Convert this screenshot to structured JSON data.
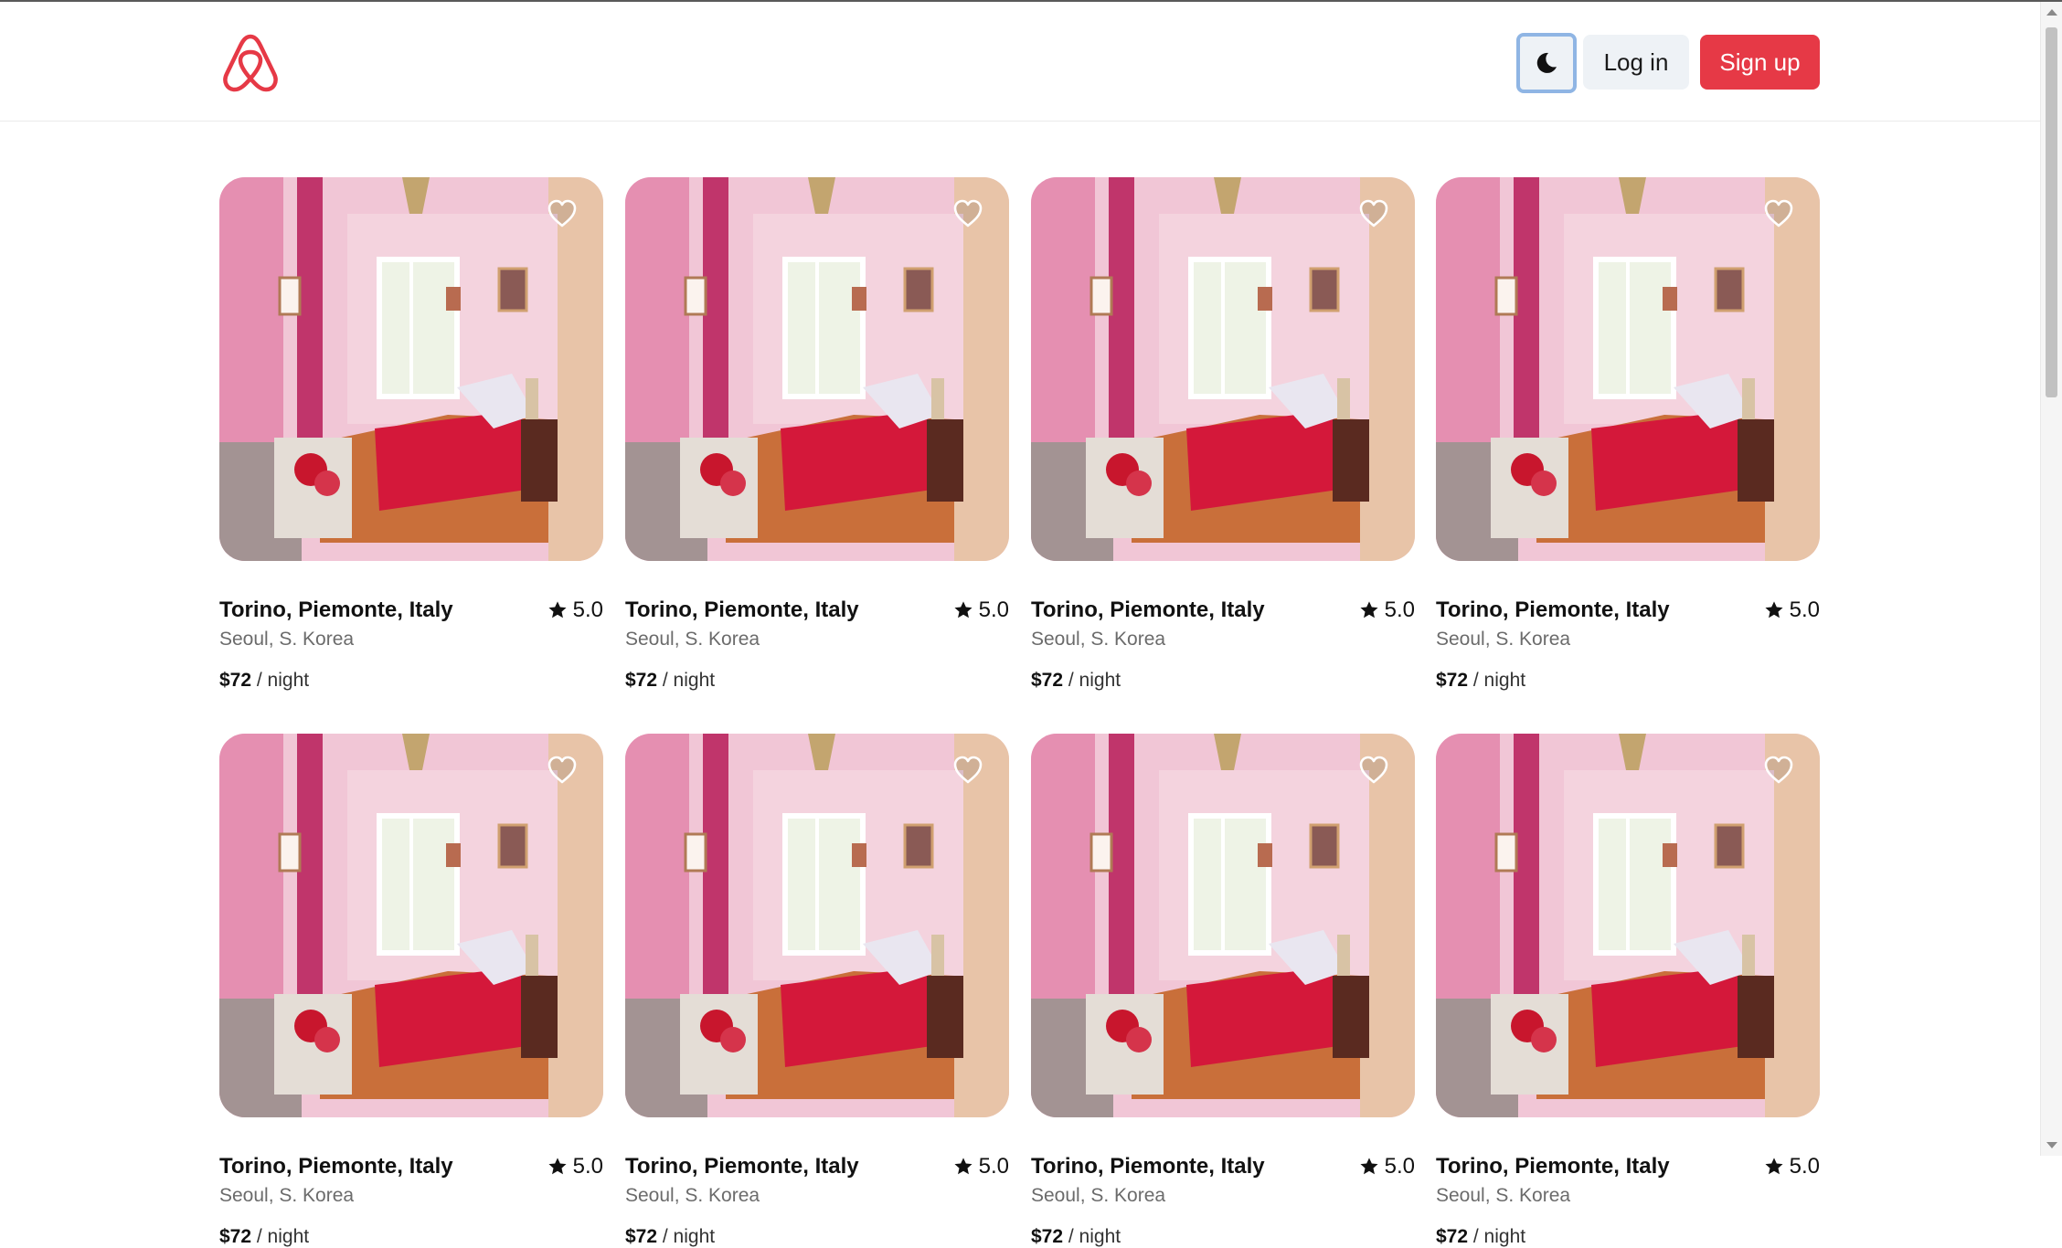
{
  "header": {
    "logo_icon": "airbnb-logo-icon",
    "theme_icon": "moon-icon",
    "login_label": "Log in",
    "signup_label": "Sign up",
    "colors": {
      "brand": "#e63946",
      "focus_ring": "#8fb5e4"
    }
  },
  "listings": [
    {
      "title": "Torino, Piemonte, Italy",
      "rating": "5.0",
      "location": "Seoul, S. Korea",
      "price": "$72",
      "per": "/ night"
    },
    {
      "title": "Torino, Piemonte, Italy",
      "rating": "5.0",
      "location": "Seoul, S. Korea",
      "price": "$72",
      "per": "/ night"
    },
    {
      "title": "Torino, Piemonte, Italy",
      "rating": "5.0",
      "location": "Seoul, S. Korea",
      "price": "$72",
      "per": "/ night"
    },
    {
      "title": "Torino, Piemonte, Italy",
      "rating": "5.0",
      "location": "Seoul, S. Korea",
      "price": "$72",
      "per": "/ night"
    },
    {
      "title": "Torino, Piemonte, Italy",
      "rating": "5.0",
      "location": "Seoul, S. Korea",
      "price": "$72",
      "per": "/ night"
    },
    {
      "title": "Torino, Piemonte, Italy",
      "rating": "5.0",
      "location": "Seoul, S. Korea",
      "price": "$72",
      "per": "/ night"
    },
    {
      "title": "Torino, Piemonte, Italy",
      "rating": "5.0",
      "location": "Seoul, S. Korea",
      "price": "$72",
      "per": "/ night"
    },
    {
      "title": "Torino, Piemonte, Italy",
      "rating": "5.0",
      "location": "Seoul, S. Korea",
      "price": "$72",
      "per": "/ night"
    }
  ]
}
